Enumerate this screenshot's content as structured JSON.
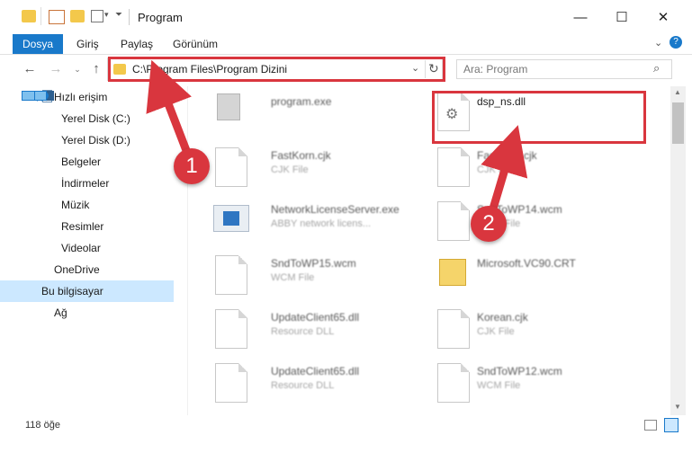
{
  "window": {
    "title": "Program"
  },
  "ribbon": {
    "tabs": [
      "Dosya",
      "Giriş",
      "Paylaş",
      "Görünüm"
    ]
  },
  "address": {
    "path": "C:\\Program Files\\Program Dizini",
    "search_placeholder": "Ara: Program"
  },
  "nav": {
    "quick_access": "Hızlı erişim",
    "items": [
      "Yerel Disk (C:)",
      "Yerel Disk (D:)",
      "Belgeler",
      "İndirmeler",
      "Müzik",
      "Resimler",
      "Videolar"
    ],
    "onedrive": "OneDrive",
    "this_pc": "Bu bilgisayar",
    "network": "Ağ"
  },
  "files": [
    {
      "name": "program.exe",
      "type": ""
    },
    {
      "name": "dsp_ns.dll",
      "type": ""
    },
    {
      "name": "FastKorn.cjk",
      "type": "CJK File"
    },
    {
      "name": "FastKorn.cjk",
      "type": "CJK File"
    },
    {
      "name": "NetworkLicenseServer.exe",
      "type": "ABBY network licens..."
    },
    {
      "name": "SndToWP14.wcm",
      "type": "WCM File"
    },
    {
      "name": "SndToWP15.wcm",
      "type": "WCM File"
    },
    {
      "name": "Microsoft.VC90.CRT",
      "type": ""
    },
    {
      "name": "UpdateClient65.dll",
      "type": "Resource DLL"
    },
    {
      "name": "Korean.cjk",
      "type": "CJK File"
    },
    {
      "name": "UpdateClient65.dll",
      "type": "Resource DLL"
    },
    {
      "name": "SndToWP12.wcm",
      "type": "WCM File"
    }
  ],
  "status": {
    "count": "118 öğe"
  },
  "callouts": [
    "1",
    "2"
  ],
  "colors": {
    "accent": "#1979ca",
    "highlight": "#d9363e",
    "selected": "#cce8ff"
  }
}
